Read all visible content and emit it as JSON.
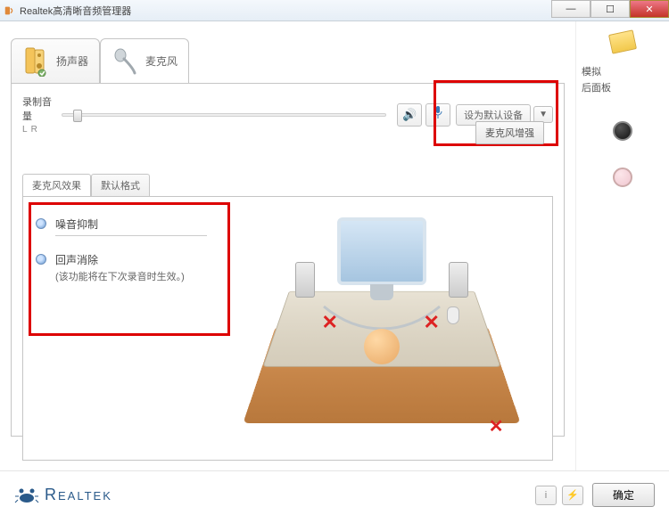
{
  "window": {
    "title": "Realtek高清晰音频管理器"
  },
  "tabs": {
    "speaker": "扬声器",
    "mic": "麦克风"
  },
  "recording": {
    "label": "录制音量",
    "L": "L",
    "R": "R"
  },
  "buttons": {
    "set_default": "设为默认设备",
    "mic_boost": "麦克风增强",
    "dropdown": "▼"
  },
  "subtabs": {
    "effects": "麦克风效果",
    "default_format": "默认格式"
  },
  "options": {
    "noise_suppression": "噪音抑制",
    "echo_cancel": "回声消除",
    "echo_note": "(该功能将在下次录音时生效。)"
  },
  "right": {
    "analog": "模拟",
    "rear": "后面板"
  },
  "footer": {
    "brand": "Realtek",
    "ok": "确定",
    "info": "i"
  },
  "icons": {
    "speaker_btn": "🔊",
    "mic_btn": "🎤"
  }
}
